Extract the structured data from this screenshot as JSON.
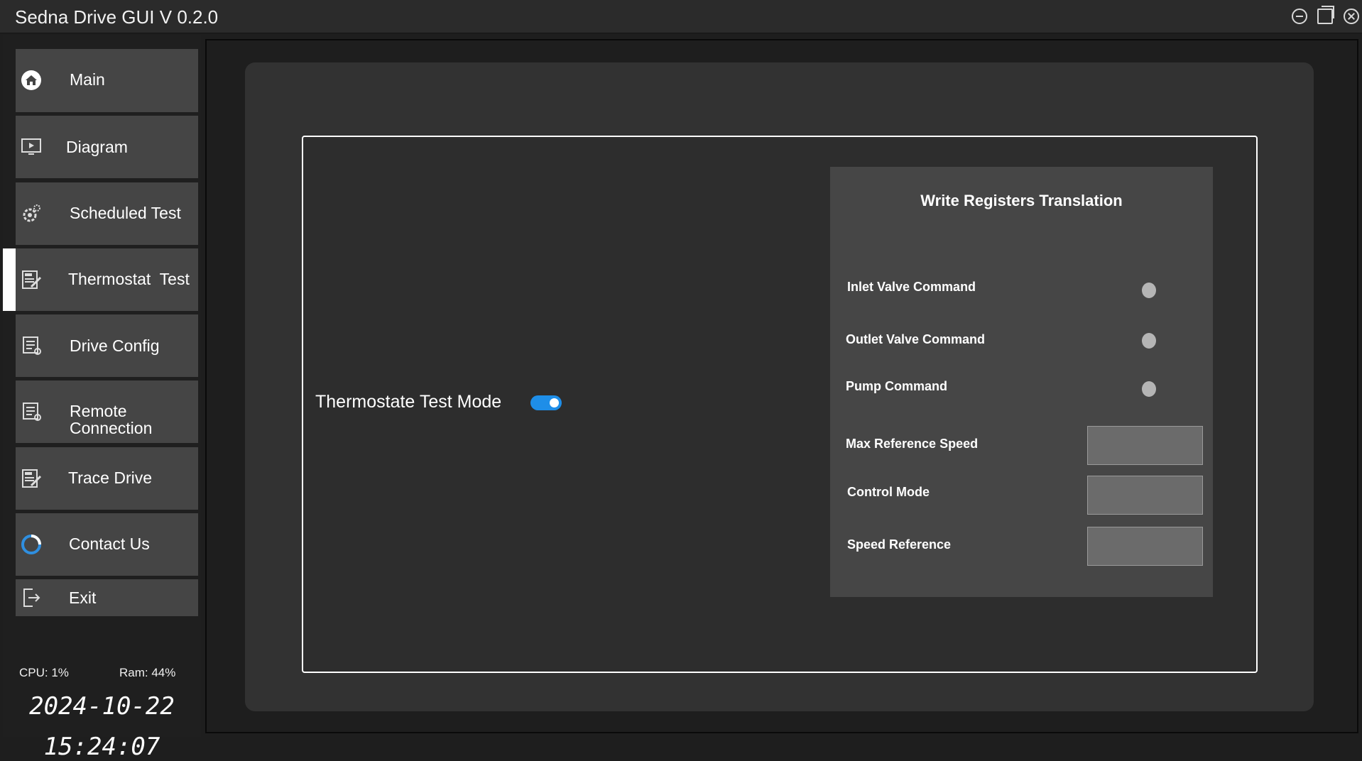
{
  "window": {
    "title": "Sedna Drive GUI V 0.2.0",
    "controls": [
      "minimize-icon",
      "maximize-icon",
      "close-icon"
    ]
  },
  "sidebar": {
    "items": [
      {
        "label": "Main",
        "icon": "home-icon"
      },
      {
        "label": "Diagram",
        "icon": "monitor-icon"
      },
      {
        "label": "Scheduled Test",
        "icon": "gear-icon"
      },
      {
        "label": "Thermostat  Test",
        "icon": "test-sheet-icon",
        "active": true
      },
      {
        "label": "Drive Config",
        "icon": "config-icon"
      },
      {
        "label": "Remote\nConnection",
        "icon": "remote-icon"
      },
      {
        "label": "Trace Drive",
        "icon": "test-sheet-icon"
      },
      {
        "label": "Contact Us",
        "icon": "ring-icon"
      },
      {
        "label": "Exit",
        "icon": "exit-icon"
      }
    ],
    "cpu": "CPU: 1%",
    "ram": "Ram: 44%",
    "date": "2024-10-22",
    "time": "15:24:07"
  },
  "main": {
    "mode_label": "Thermostate Test Mode",
    "mode_enabled": true,
    "toggle_color": "#1e8ee8",
    "register_panel": {
      "title": "Write Registers Translation",
      "indicators": [
        {
          "label": "Inlet Valve Command",
          "state": "off"
        },
        {
          "label": "Outlet Valve Command",
          "state": "off"
        },
        {
          "label": "Pump Command",
          "state": "off"
        }
      ],
      "fields": [
        {
          "label": "Max Reference Speed",
          "value": ""
        },
        {
          "label": "Control Mode",
          "value": ""
        },
        {
          "label": "Speed Reference",
          "value": ""
        }
      ]
    }
  }
}
